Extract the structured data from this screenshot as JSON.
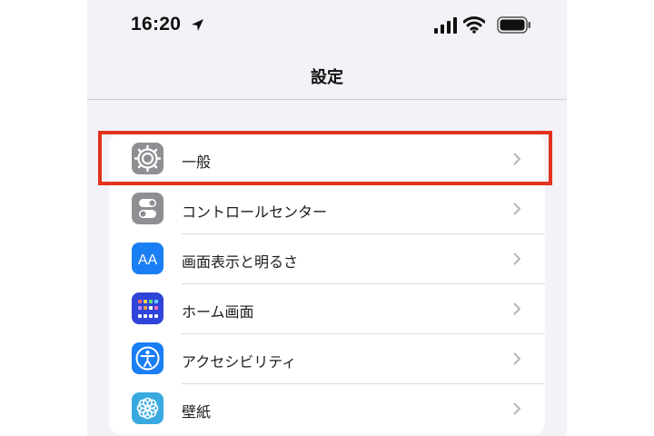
{
  "status_bar": {
    "time": "16:20",
    "icons": [
      "location-arrow-icon",
      "cellular-signal-icon",
      "wifi-icon",
      "battery-icon"
    ]
  },
  "nav": {
    "title": "設定"
  },
  "settings": {
    "items": [
      {
        "label": "一般",
        "icon": "gear-icon",
        "color": "#8e8e93"
      },
      {
        "label": "コントロールセンター",
        "icon": "toggles-icon",
        "color": "#8e8e93"
      },
      {
        "label": "画面表示と明るさ",
        "icon": "text-size-icon",
        "color": "#1a7ef5"
      },
      {
        "label": "ホーム画面",
        "icon": "app-grid-icon",
        "color": "#2f45d9"
      },
      {
        "label": "アクセシビリティ",
        "icon": "accessibility-icon",
        "color": "#1a7ef5"
      },
      {
        "label": "壁紙",
        "icon": "flower-icon",
        "color": "#39a9e0"
      }
    ]
  },
  "icon_text": {
    "display": "AA"
  },
  "highlight": {
    "color": "#e3321e",
    "target": "一般"
  }
}
